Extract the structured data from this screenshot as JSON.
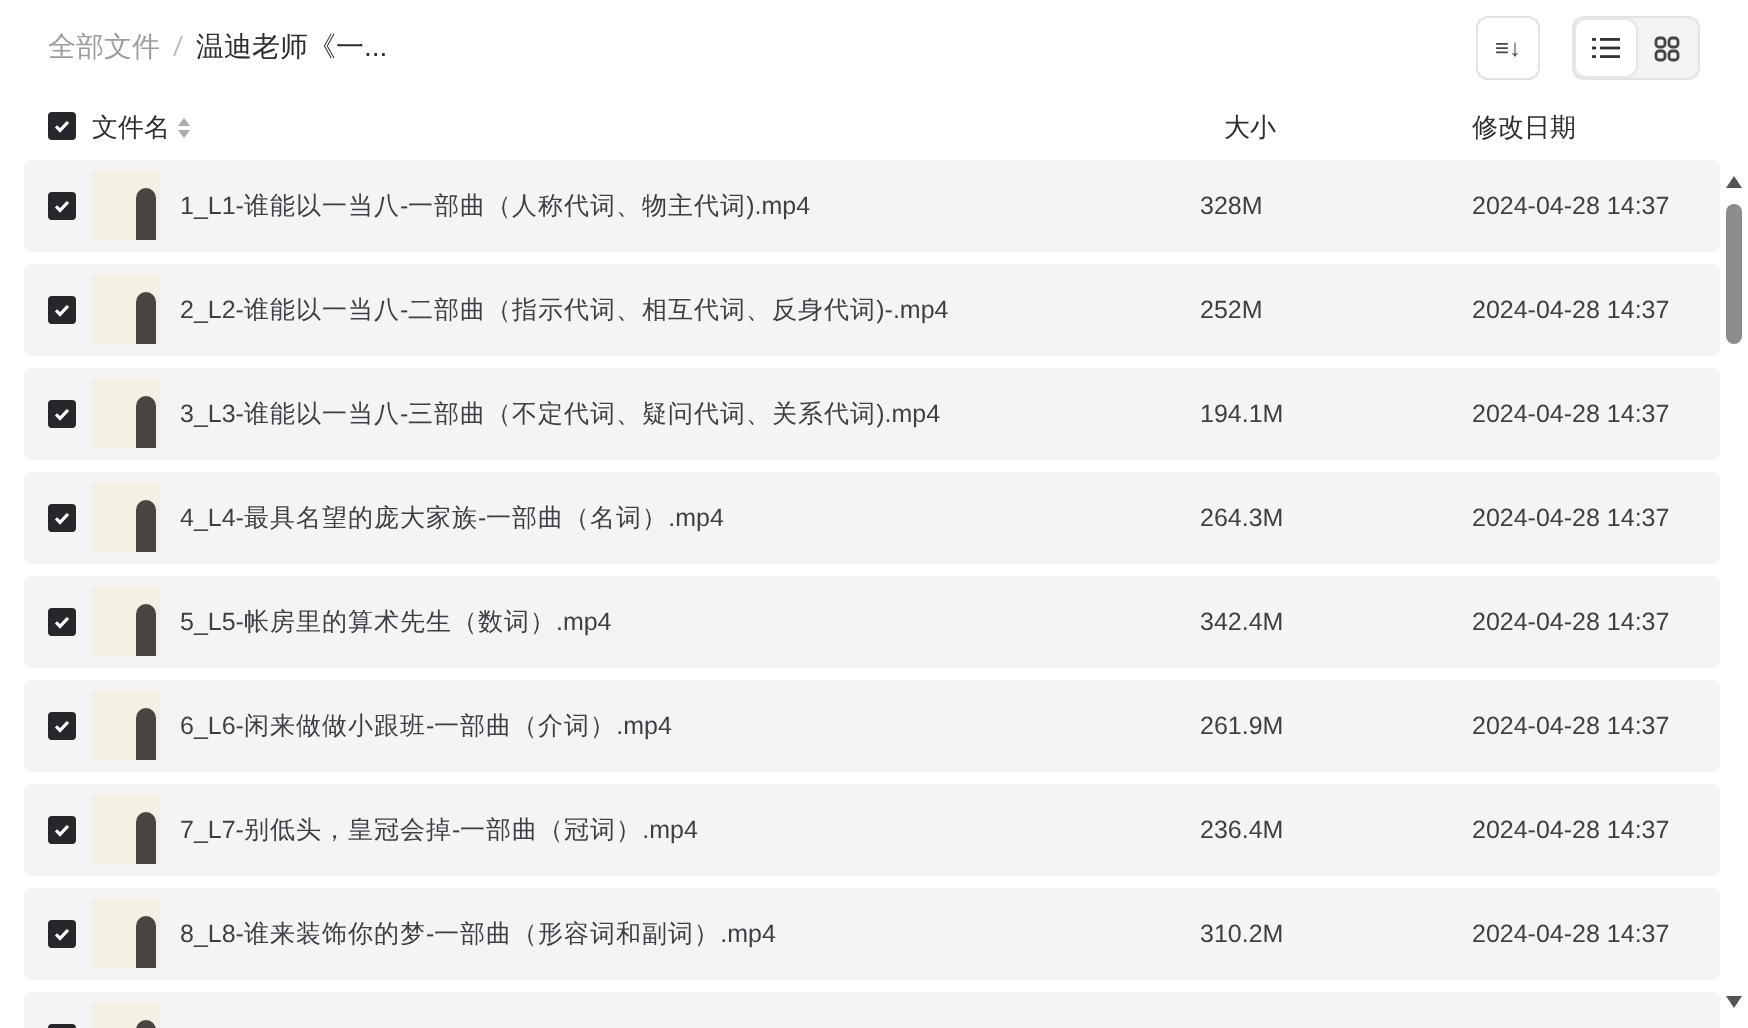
{
  "breadcrumb": [
    {
      "label": "全部文件",
      "current": false
    },
    {
      "label": "温迪老师《一...",
      "current": true
    }
  ],
  "toolbar": {
    "sort_button": "≡↓",
    "view_modes": [
      {
        "kind": "list",
        "selected": true
      },
      {
        "kind": "grid",
        "selected": false
      }
    ]
  },
  "table": {
    "select_all": {
      "checked": true
    },
    "columns": [
      {
        "label": "文件名",
        "sortable": true
      },
      {
        "label": "大小",
        "sortable": false
      },
      {
        "label": "修改日期",
        "sortable": false
      }
    ],
    "rows": [
      {
        "checked": true,
        "name": "1_L1-谁能以一当八-一部曲（人称代词、物主代词).mp4",
        "size": "328M",
        "modified": "2024-04-28 14:37"
      },
      {
        "checked": true,
        "name": "2_L2-谁能以一当八-二部曲（指示代词、相互代词、反身代词)-.mp4",
        "size": "252M",
        "modified": "2024-04-28 14:37"
      },
      {
        "checked": true,
        "name": "3_L3-谁能以一当八-三部曲（不定代词、疑问代词、关系代词).mp4",
        "size": "194.1M",
        "modified": "2024-04-28 14:37"
      },
      {
        "checked": true,
        "name": "4_L4-最具名望的庞大家族-一部曲（名词）.mp4",
        "size": "264.3M",
        "modified": "2024-04-28 14:37"
      },
      {
        "checked": true,
        "name": "5_L5-帐房里的算术先生（数词）.mp4",
        "size": "342.4M",
        "modified": "2024-04-28 14:37"
      },
      {
        "checked": true,
        "name": "6_L6-闲来做做小跟班-一部曲（介词）.mp4",
        "size": "261.9M",
        "modified": "2024-04-28 14:37"
      },
      {
        "checked": true,
        "name": "7_L7-别低头，皇冠会掉-一部曲（冠词）.mp4",
        "size": "236.4M",
        "modified": "2024-04-28 14:37"
      },
      {
        "checked": true,
        "name": "8_L8-谁来装饰你的梦-一部曲（形容词和副词）.mp4",
        "size": "310.2M",
        "modified": "2024-04-28 14:37"
      },
      {
        "checked": true
      }
    ]
  }
}
